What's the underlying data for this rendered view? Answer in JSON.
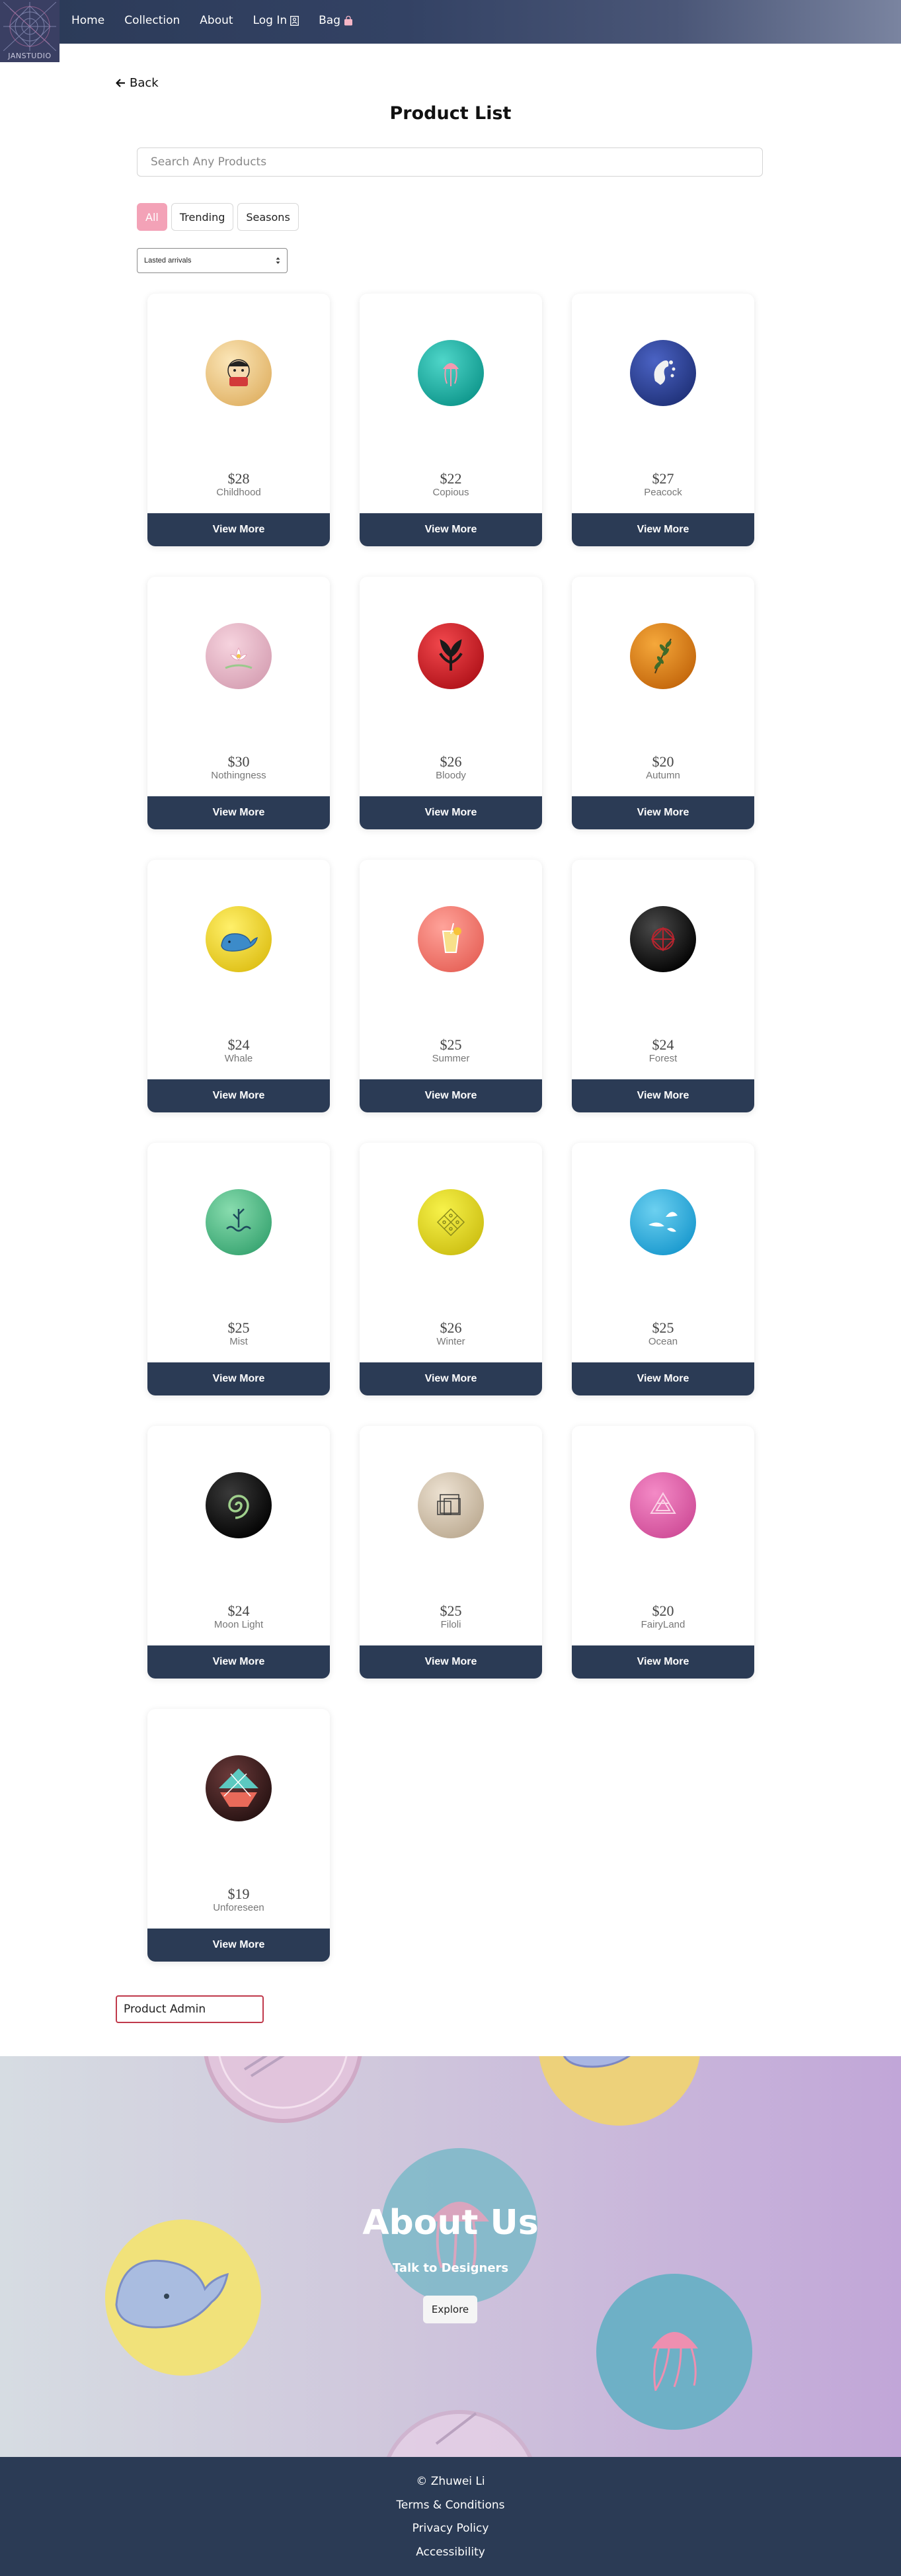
{
  "nav": {
    "logo_text": "JANSTUDIO",
    "links": [
      {
        "label": "Home"
      },
      {
        "label": "Collection"
      },
      {
        "label": "About"
      },
      {
        "label": "Log In"
      },
      {
        "label": "Bag"
      }
    ]
  },
  "main": {
    "back_label": "Back",
    "title": "Product List",
    "search_placeholder": "Search Any Products",
    "filters": [
      "All",
      "Trending",
      "Seasons"
    ],
    "active_filter": "All",
    "sort_selected": "Lasted arrivals",
    "view_more_label": "View More",
    "products": [
      {
        "price": "$28",
        "name": "Childhood"
      },
      {
        "price": "$22",
        "name": "Copious"
      },
      {
        "price": "$27",
        "name": "Peacock"
      },
      {
        "price": "$30",
        "name": "Nothingness"
      },
      {
        "price": "$26",
        "name": "Bloody"
      },
      {
        "price": "$20",
        "name": "Autumn"
      },
      {
        "price": "$24",
        "name": "Whale"
      },
      {
        "price": "$25",
        "name": "Summer"
      },
      {
        "price": "$24",
        "name": "Forest"
      },
      {
        "price": "$25",
        "name": "Mist"
      },
      {
        "price": "$26",
        "name": "Winter"
      },
      {
        "price": "$25",
        "name": "Ocean"
      },
      {
        "price": "$24",
        "name": "Moon Light"
      },
      {
        "price": "$25",
        "name": "Filoli"
      },
      {
        "price": "$20",
        "name": "FairyLand"
      },
      {
        "price": "$19",
        "name": "Unforeseen"
      }
    ],
    "admin_label": "Product Admin"
  },
  "about": {
    "title": "About Us",
    "subtitle": "Talk to Designers",
    "explore_label": "Explore"
  },
  "footer": {
    "copyright": "© Zhuwei Li",
    "links": [
      "Terms & Conditions",
      "Privacy Policy",
      "Accessibility"
    ]
  },
  "colors": {
    "nav_dark": "#2b3a57",
    "button_dark": "#2b3b55",
    "active_pink": "#f3a2b7",
    "admin_border": "#c0394b"
  },
  "icons": {
    "back": "arrow-left-icon",
    "login": "user-icon",
    "bag": "shopping-bag-icon",
    "sort": "sort-arrows-icon"
  }
}
